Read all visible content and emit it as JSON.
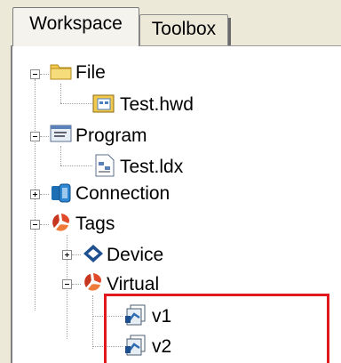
{
  "tabs": [
    {
      "label": "Workspace",
      "active": true
    },
    {
      "label": "Toolbox",
      "active": false
    }
  ],
  "tree": {
    "file": {
      "label": "File",
      "icon": "folder-icon",
      "expanded": true,
      "children": [
        {
          "label": "Test.hwd",
          "icon": "hwd-file-icon"
        }
      ]
    },
    "program": {
      "label": "Program",
      "icon": "program-icon",
      "expanded": true,
      "children": [
        {
          "label": "Test.ldx",
          "icon": "ldx-file-icon"
        }
      ]
    },
    "connection": {
      "label": "Connection",
      "icon": "connection-icon",
      "expanded": false
    },
    "tags": {
      "label": "Tags",
      "icon": "tags-icon",
      "expanded": true,
      "children": {
        "device": {
          "label": "Device",
          "icon": "device-icon",
          "expanded": false
        },
        "virtual": {
          "label": "Virtual",
          "icon": "virtual-tags-icon",
          "expanded": true,
          "children": [
            {
              "label": "v1",
              "icon": "virtual-tag-icon"
            },
            {
              "label": "v2",
              "icon": "virtual-tag-icon"
            }
          ]
        }
      }
    }
  },
  "colors": {
    "highlight": "#e0191f",
    "folder": "#f2c94c",
    "tags": "#e0492a",
    "connection": "#1d6fb5"
  }
}
